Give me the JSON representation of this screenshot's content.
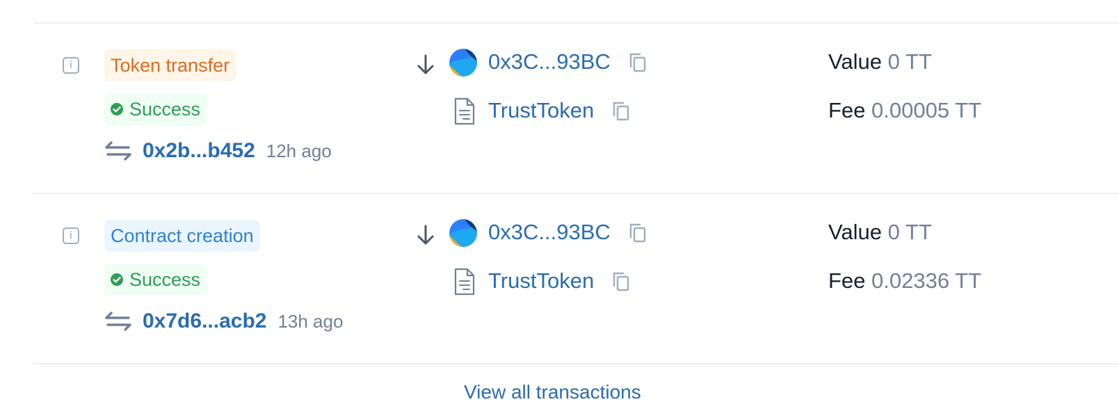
{
  "transactions": [
    {
      "type_label": "Token transfer",
      "type_kind": "token",
      "status_label": "Success",
      "hash": "0x2b...b452",
      "time_ago": "12h ago",
      "from_address": "0x3C...93BC",
      "to_contract": "TrustToken",
      "value_label": "Value",
      "value_amount": "0 TT",
      "fee_label": "Fee",
      "fee_amount": "0.00005 TT"
    },
    {
      "type_label": "Contract creation",
      "type_kind": "contract",
      "status_label": "Success",
      "hash": "0x7d6...acb2",
      "time_ago": "13h ago",
      "from_address": "0x3C...93BC",
      "to_contract": "TrustToken",
      "value_label": "Value",
      "value_amount": "0 TT",
      "fee_label": "Fee",
      "fee_amount": "0.02336 TT"
    }
  ],
  "footer": {
    "view_all_label": "View all transactions"
  },
  "icons": {
    "info": "info-icon",
    "status": "check-circle-icon",
    "tx_hash": "swap-arrows-icon",
    "direction": "arrow-down-icon",
    "address": "avatar-identicon",
    "copy": "copy-icon",
    "contract": "document-icon"
  },
  "colors": {
    "token_badge_bg": "#fff5e9",
    "token_badge_text": "#dd6b20",
    "contract_badge_bg": "#ebf5ff",
    "contract_badge_text": "#2b82d9",
    "success_bg": "#f0fff4",
    "success_text": "#2f9e57",
    "link": "#2b6cb0",
    "muted": "#718096"
  }
}
